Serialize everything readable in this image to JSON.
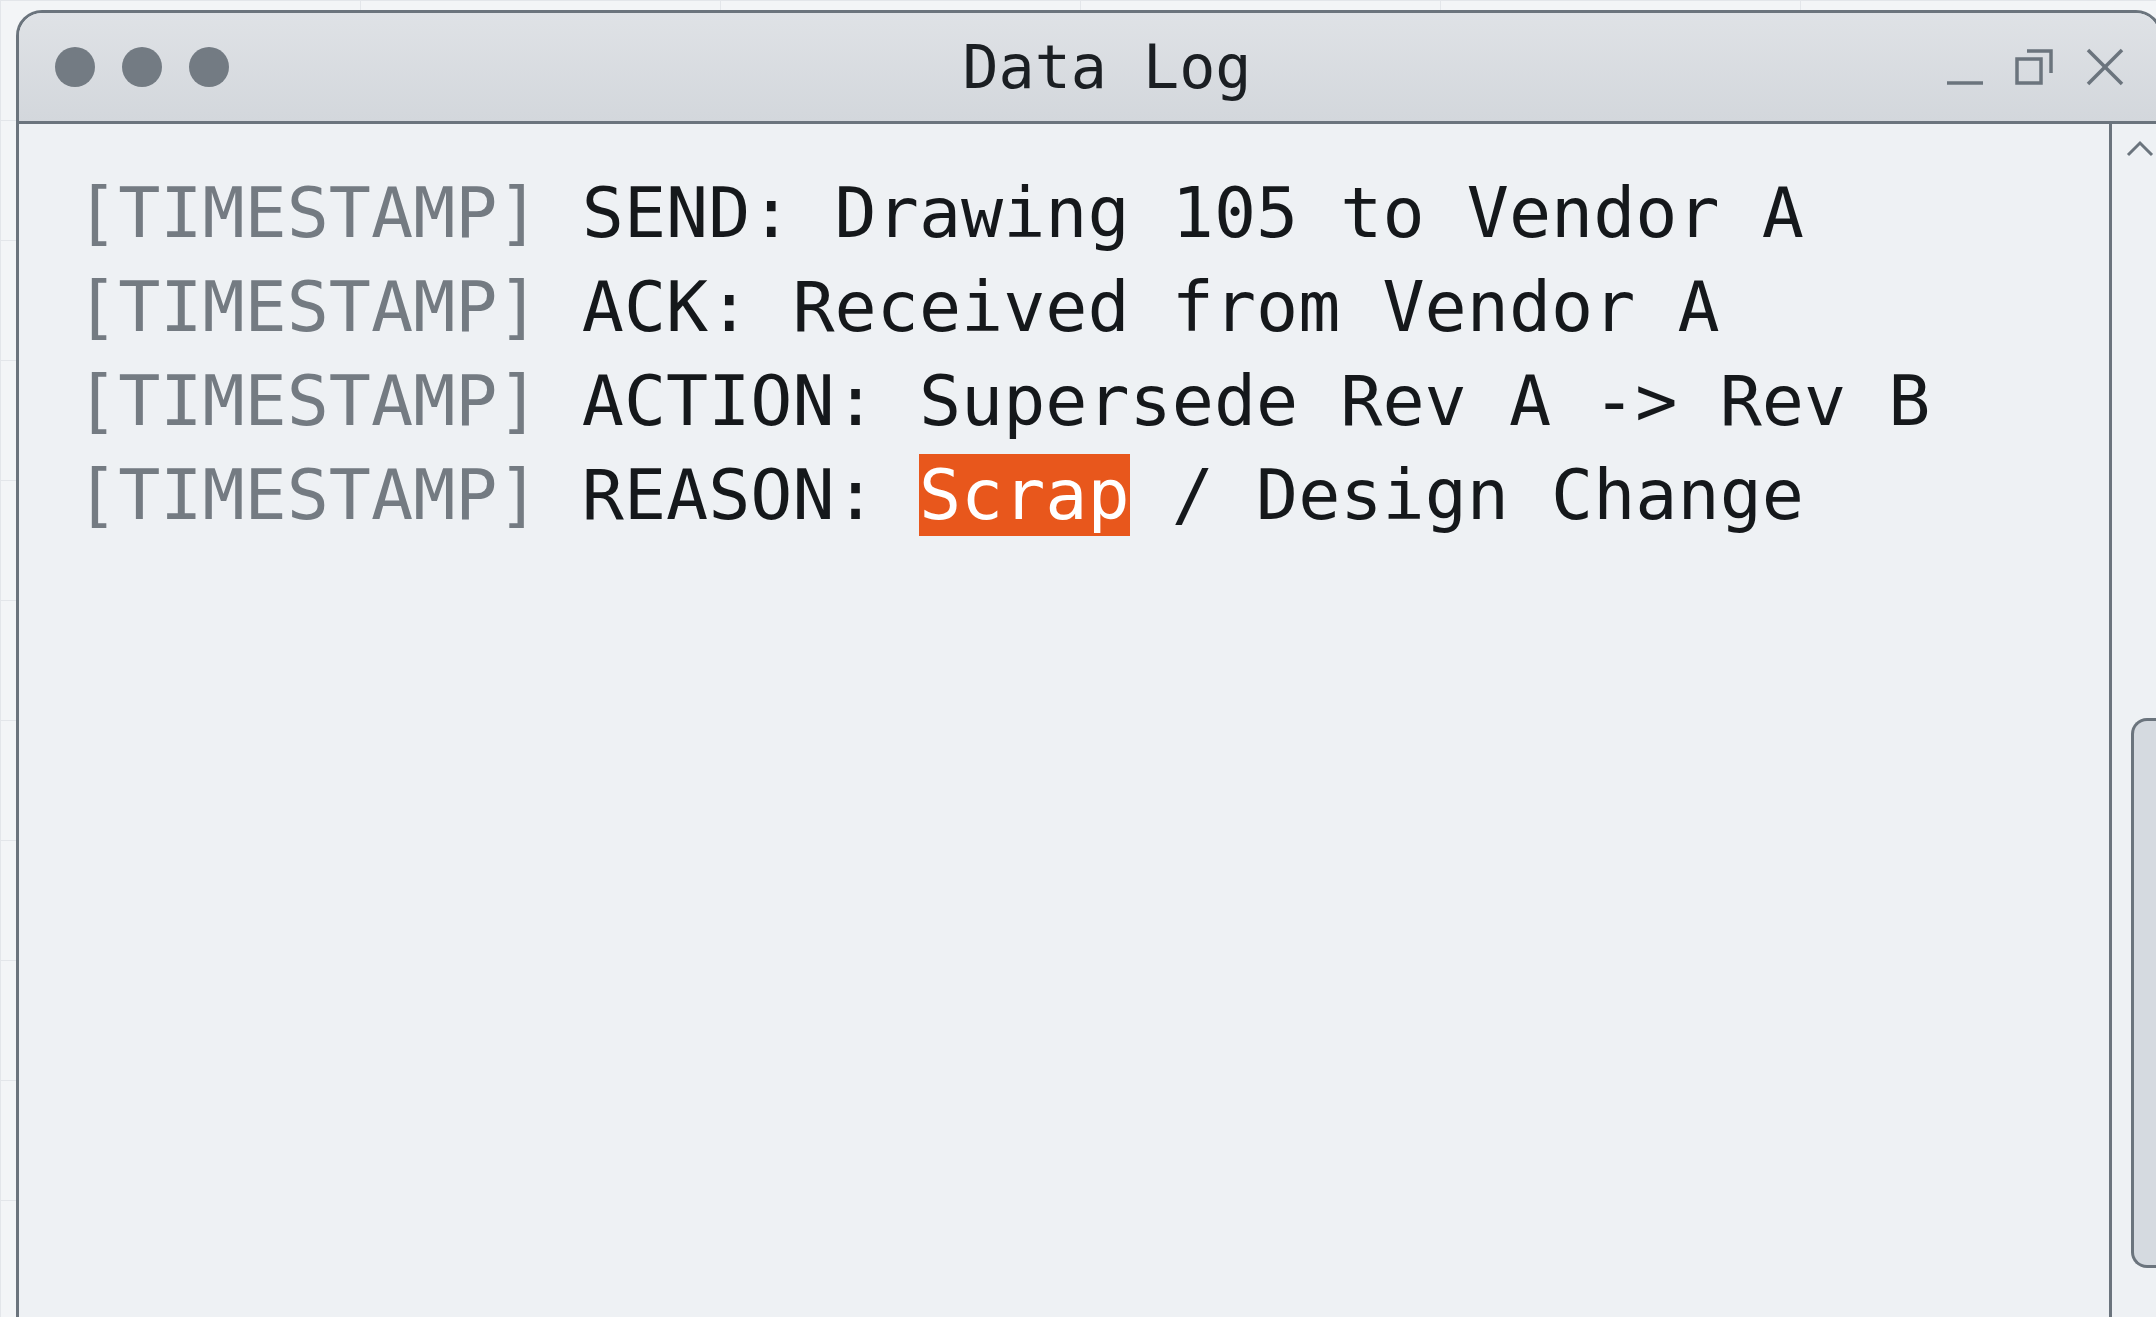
{
  "window": {
    "title": "Data Log"
  },
  "log": [
    {
      "timestamp": "[TIMESTAMP]",
      "segments": [
        {
          "text": "SEND: Drawing 105 to Vendor A",
          "highlighted": false
        }
      ]
    },
    {
      "timestamp": "[TIMESTAMP]",
      "segments": [
        {
          "text": "ACK: Received from Vendor A",
          "highlighted": false
        }
      ]
    },
    {
      "timestamp": "[TIMESTAMP]",
      "segments": [
        {
          "text": "ACTION: Supersede Rev A -> Rev B",
          "highlighted": false
        }
      ]
    },
    {
      "timestamp": "[TIMESTAMP]",
      "segments": [
        {
          "text": "REASON: ",
          "highlighted": false
        },
        {
          "text": "Scrap",
          "highlighted": true
        },
        {
          "text": " / Design Change",
          "highlighted": false
        }
      ]
    }
  ]
}
